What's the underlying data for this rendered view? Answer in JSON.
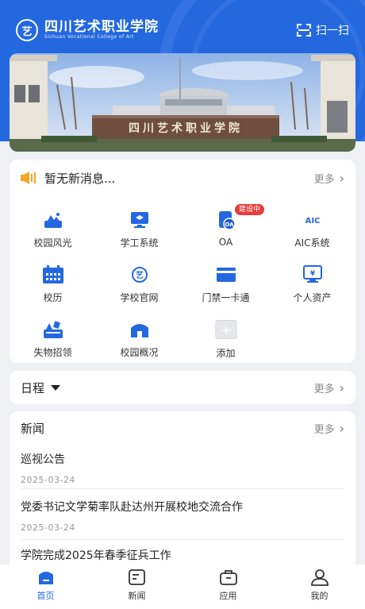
{
  "header": {
    "logo_mark": "艺",
    "college_name": "四川艺术职业学院",
    "college_name_en": "Sichuan Vocational College of Art",
    "scan_label": "扫一扫"
  },
  "banner": {
    "gate_text": "四川艺术职业学院"
  },
  "notice": {
    "text": "暂无新消息...",
    "more_label": "更多",
    "chevron": "›"
  },
  "apps": [
    {
      "label": "校园风光",
      "icon": "landscape-icon"
    },
    {
      "label": "学工系统",
      "icon": "monitor-icon"
    },
    {
      "label": "OA",
      "icon": "oa-icon",
      "badge": "建设中",
      "icon_text": "OA"
    },
    {
      "label": "AIC系统",
      "icon": "aic-icon",
      "icon_text": "AIC"
    },
    {
      "label": "校历",
      "icon": "calendar-icon"
    },
    {
      "label": "学校官网",
      "icon": "school-logo-icon",
      "icon_text": "艺"
    },
    {
      "label": "门禁一卡通",
      "icon": "card-icon"
    },
    {
      "label": "个人资产",
      "icon": "asset-monitor-icon",
      "icon_text": "¥"
    },
    {
      "label": "失物招领",
      "icon": "lost-found-icon"
    },
    {
      "label": "校园概况",
      "icon": "building-icon"
    },
    {
      "label": "添加",
      "icon": "add-icon",
      "icon_text": "+"
    }
  ],
  "schedule": {
    "title": "日程",
    "more_label": "更多",
    "chevron": "›"
  },
  "news": {
    "title": "新闻",
    "more_label": "更多",
    "chevron": "›",
    "items": [
      {
        "title": "巡视公告",
        "date": "2025-03-24"
      },
      {
        "title": "党委书记文学菊率队赴达州开展校地交流合作",
        "date": "2025-03-24"
      },
      {
        "title": "学院完成2025年春季征兵工作",
        "date": ""
      }
    ]
  },
  "tabs": [
    {
      "label": "首页",
      "icon": "home-icon",
      "active": true
    },
    {
      "label": "新闻",
      "icon": "news-icon"
    },
    {
      "label": "应用",
      "icon": "apps-icon"
    },
    {
      "label": "我的",
      "icon": "profile-icon"
    }
  ],
  "colors": {
    "primary": "#2468e0",
    "badge": "#e83b3b",
    "notice": "#f5a623"
  }
}
